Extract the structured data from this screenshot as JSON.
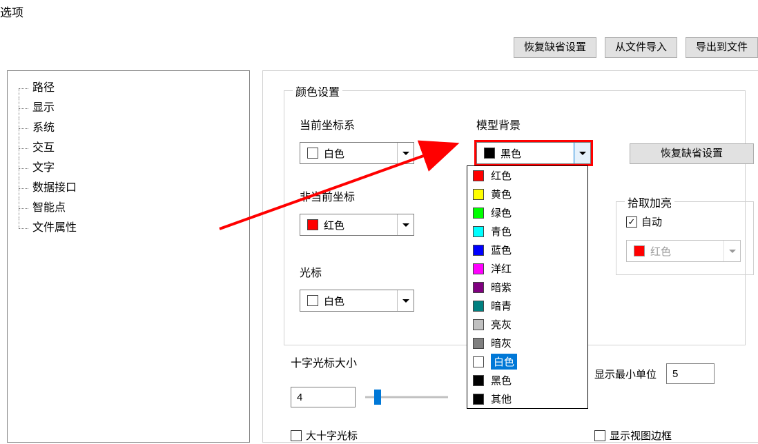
{
  "title": "选项",
  "top_buttons": {
    "restore_defaults": "恢复缺省设置",
    "import_file": "从文件导入",
    "export_file": "导出到文件"
  },
  "tree": {
    "items": [
      "路径",
      "显示",
      "系统",
      "交互",
      "文字",
      "数据接口",
      "智能点",
      "文件属性"
    ]
  },
  "color_group": {
    "title": "颜色设置",
    "current_cs": {
      "label": "当前坐标系",
      "value": "白色",
      "swatch": "#ffffff"
    },
    "non_current": {
      "label": "非当前坐标",
      "value": "红色",
      "swatch": "#ff0000"
    },
    "cursor": {
      "label": "光标",
      "value": "白色",
      "swatch": "#ffffff"
    },
    "model_bg": {
      "label": "模型背景",
      "value": "黑色",
      "swatch": "#000000"
    },
    "restore": "恢复缺省设置",
    "highlight_group": {
      "title": "拾取加亮",
      "auto": "自动",
      "value": "红色",
      "swatch": "#ff0000"
    }
  },
  "dropdown_items": [
    {
      "label": "红色",
      "color": "#ff0000"
    },
    {
      "label": "黄色",
      "color": "#ffff00"
    },
    {
      "label": "绿色",
      "color": "#00ff00"
    },
    {
      "label": "青色",
      "color": "#00ffff"
    },
    {
      "label": "蓝色",
      "color": "#0000ff"
    },
    {
      "label": "洋红",
      "color": "#ff00ff"
    },
    {
      "label": "暗紫",
      "color": "#800080"
    },
    {
      "label": "暗青",
      "color": "#008080"
    },
    {
      "label": "亮灰",
      "color": "#c0c0c0"
    },
    {
      "label": "暗灰",
      "color": "#808080"
    },
    {
      "label": "白色",
      "color": "#ffffff",
      "selected": true
    },
    {
      "label": "黑色",
      "color": "#000000"
    },
    {
      "label": "其他",
      "color": "#000000"
    }
  ],
  "cross_cursor": {
    "label": "十字光标大小",
    "value": "4",
    "big_cursor": "大十字光标",
    "min_unit_label": "显示最小单位",
    "min_unit_value": "5",
    "show_view_border": "显示视图边框"
  }
}
